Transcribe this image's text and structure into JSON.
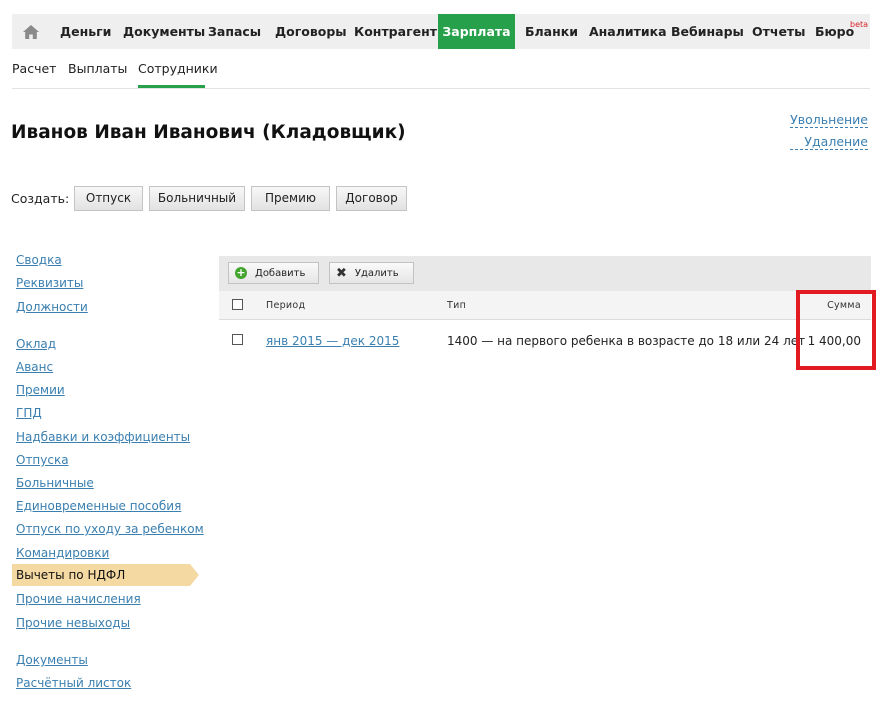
{
  "topnav": {
    "items": [
      "Деньги",
      "Документы",
      "Запасы",
      "Договоры",
      "Контрагенты",
      "Зарплата",
      "Бланки",
      "Аналитика",
      "Вебинары",
      "Отчеты",
      "Бюро"
    ],
    "beta": "beta",
    "active_color": "#26a04a"
  },
  "subnav": {
    "items": [
      "Расчет",
      "Выплаты",
      "Сотрудники"
    ]
  },
  "employee": {
    "title": "Иванов Иван Иванович (Кладовщик)",
    "dismiss": "Увольнение",
    "delete": "Удаление"
  },
  "create": {
    "label": "Создать:",
    "buttons": [
      "Отпуск",
      "Больничный",
      "Премию",
      "Договор"
    ]
  },
  "sidebar": {
    "items": [
      "Сводка",
      "Реквизиты",
      "Должности",
      "Оклад",
      "Аванс",
      "Премии",
      "ГПД",
      "Надбавки и коэффициенты",
      "Отпуска",
      "Больничные",
      "Единовременные пособия",
      "Отпуск по уходу за ребенком",
      "Командировки",
      "Вычеты по НДФЛ",
      "Прочие начисления",
      "Прочие невыходы",
      "Документы",
      "Расчётный листок"
    ],
    "active": "Вычеты по НДФЛ"
  },
  "toolbar": {
    "add": "Добавить",
    "remove": "Удалить"
  },
  "table": {
    "headers": {
      "period": "Период",
      "type": "Тип",
      "amount": "Сумма"
    },
    "rows": [
      {
        "period": "янв 2015 — дек 2015",
        "type": "1400 — на первого ребенка в возрасте до 18 или 24 лет",
        "amount": "1 400,00"
      }
    ]
  },
  "colors": {
    "highlight": "#e21b22",
    "link": "#3a7fb0",
    "active_sidebar": "#f5d9a3"
  }
}
